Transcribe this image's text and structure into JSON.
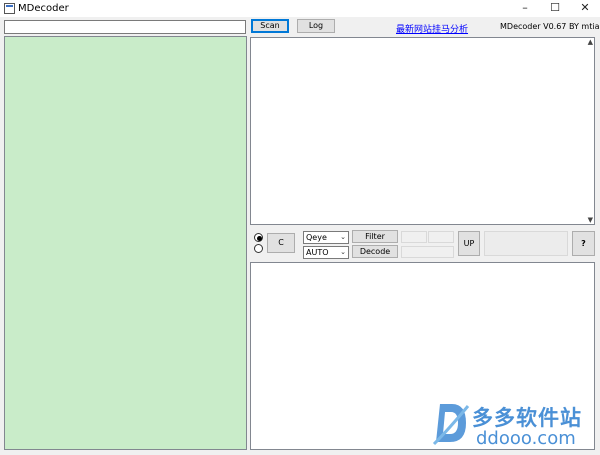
{
  "window": {
    "title": "MDecoder",
    "buttons": {
      "minimize": "–",
      "maximize": "☐",
      "close": "✕"
    }
  },
  "toolbar": {
    "path_value": "",
    "scan_label": "Scan",
    "log_label": "Log",
    "link_text": "最新网站挂马分析",
    "version_text": "MDecoder V0.67   BY mtian"
  },
  "colors": {
    "left_panel": "#c9ecc9",
    "link": "#0000ff",
    "watermark": "#4a90d6"
  },
  "controls": {
    "c_label": "C",
    "select1_value": "Qeye",
    "select2_value": "AUTO",
    "filter_label": "Filter",
    "decode_label": "Decode",
    "up_label": "UP",
    "help_label": "?",
    "radio_selected": "top"
  },
  "watermark": {
    "cn_text": "多多软件站",
    "url_text": "ddooo.com"
  }
}
